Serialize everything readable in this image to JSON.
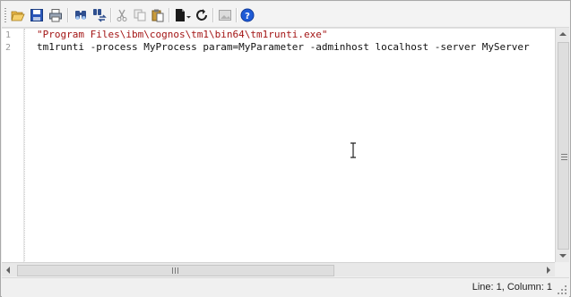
{
  "toolbar": {
    "buttons": [
      {
        "name": "open-folder-icon"
      },
      {
        "name": "save-icon"
      },
      {
        "name": "print-icon"
      },
      {
        "name": "find-icon"
      },
      {
        "name": "replace-icon"
      },
      {
        "name": "cut-icon"
      },
      {
        "name": "copy-icon"
      },
      {
        "name": "paste-icon"
      },
      {
        "name": "new-document-dropdown-icon"
      },
      {
        "name": "refresh-icon"
      },
      {
        "name": "image-icon"
      },
      {
        "name": "help-icon"
      }
    ]
  },
  "editor": {
    "line_numbers": [
      "1",
      "2"
    ],
    "lines": [
      "\"Program Files\\ibm\\cognos\\tm1\\bin64\\tm1runti.exe\"",
      "tm1runti -process MyProcess param=MyParameter -adminhost localhost -server MyServer"
    ]
  },
  "status": {
    "position": "Line: 1, Column: 1"
  },
  "colors": {
    "string": "#a31515",
    "text": "#111111",
    "line_number": "#9a9a9a",
    "help_blue": "#1e5bd6"
  }
}
